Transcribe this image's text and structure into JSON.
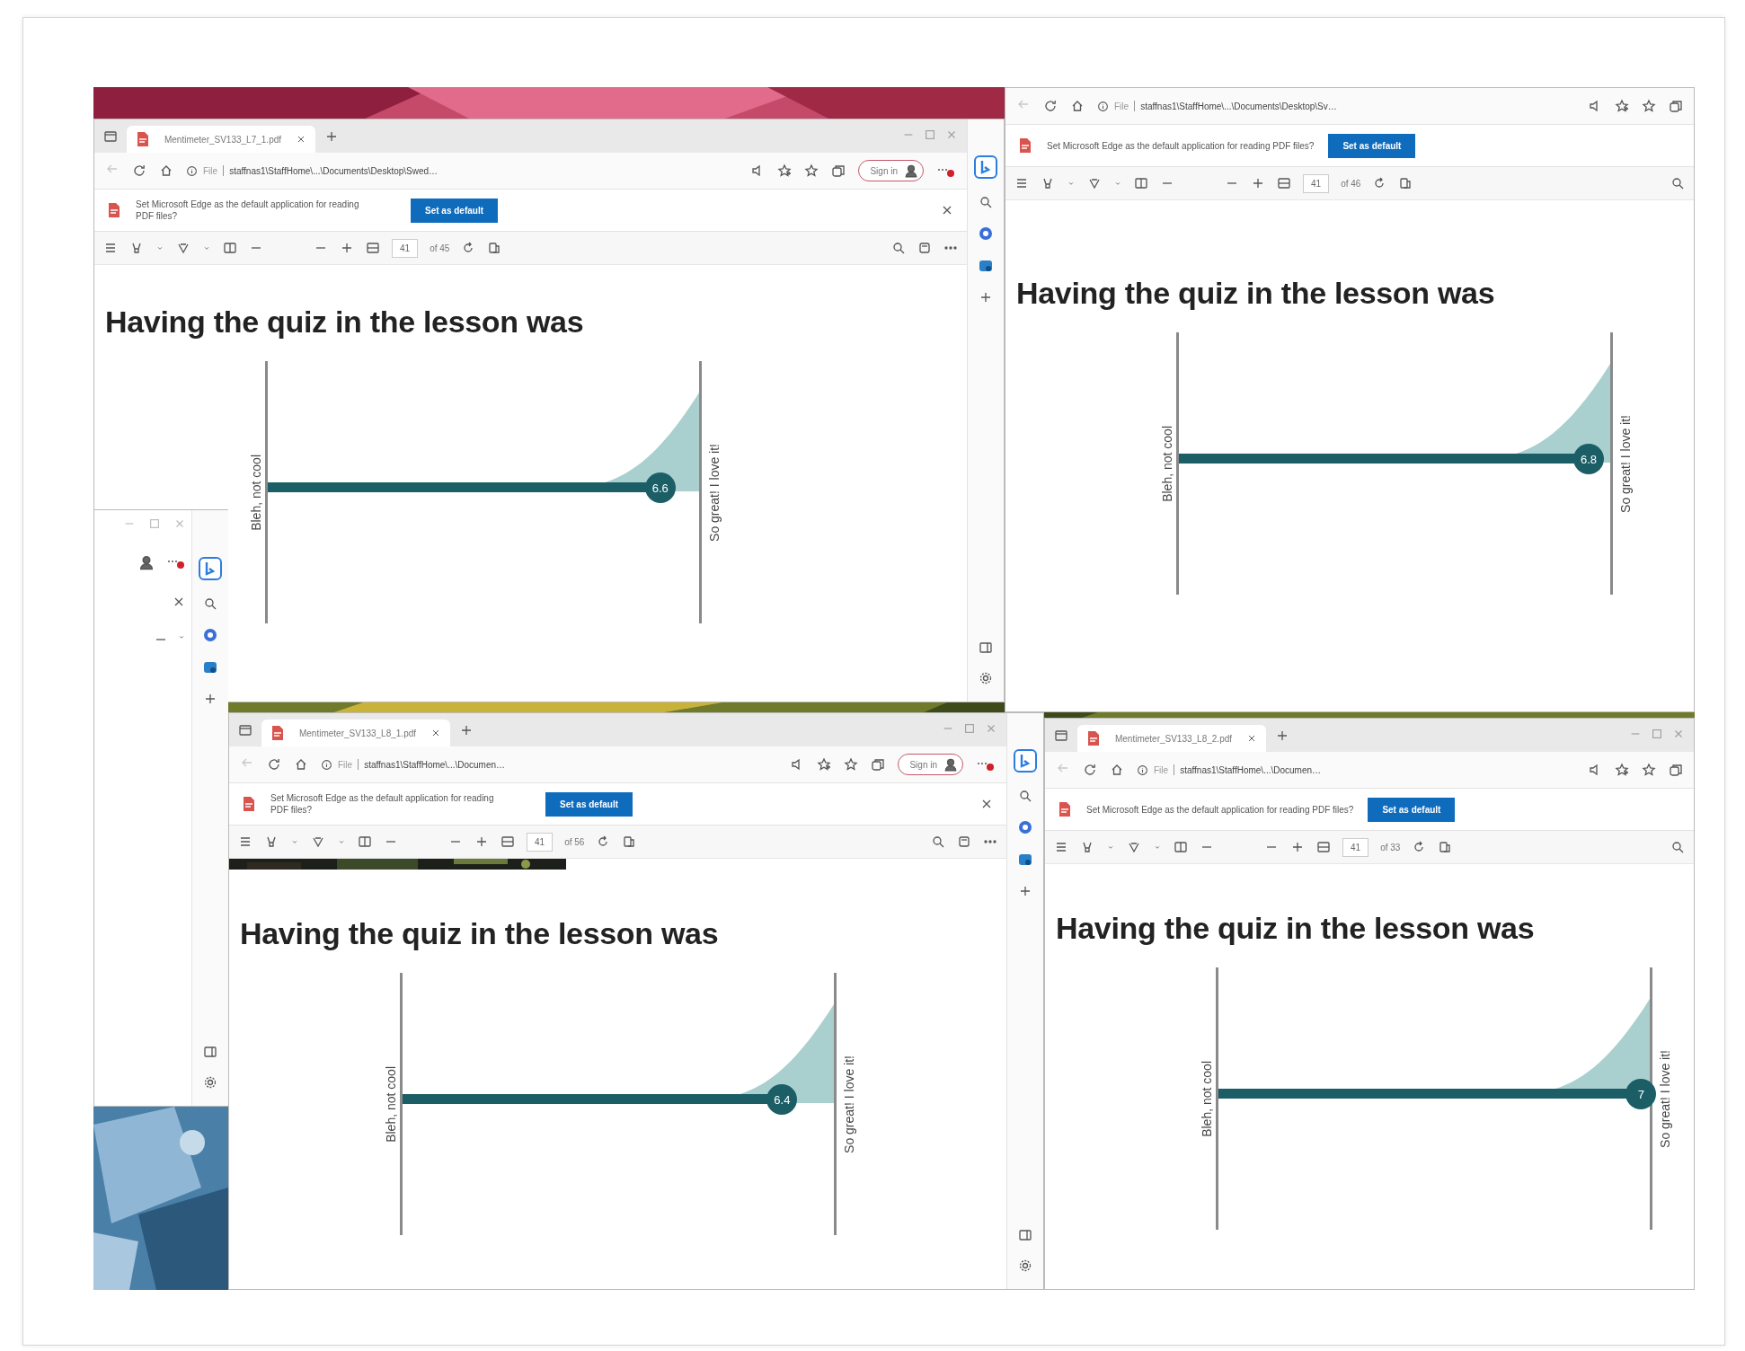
{
  "windows": [
    {
      "kind": "browser",
      "tab_title": "Mentimeter_SV133_L7_1.pdf",
      "address_scheme": "File",
      "address": "staffnas1\\StaffHome\\...\\Documents\\Desktop\\Swed…",
      "sign_in": "Sign in",
      "sidebar": true,
      "banner": {
        "text": "Set Microsoft Edge as the default application for reading PDF files?",
        "button": "Set as default"
      },
      "page": "41",
      "page_count": "of 45",
      "slide": {
        "title": "Having the quiz in the lesson was",
        "left_label": "Bleh, not cool",
        "right_label": "So great! I love it!",
        "value": "6.6",
        "level": 0.91
      }
    },
    {
      "kind": "browser",
      "address_scheme": "File",
      "address": "staffnas1\\StaffHome\\...\\Documents\\Desktop\\Sv…",
      "sidebar": false,
      "banner": {
        "text": "Set Microsoft Edge as the default application for reading PDF files?",
        "button": "Set as default"
      },
      "page": "41",
      "page_count": "of 46",
      "slide": {
        "title": "Having the quiz in the lesson was",
        "left_label": "Bleh, not cool",
        "right_label": "So great! I love it!",
        "value": "6.8",
        "level": 0.95
      }
    },
    {
      "kind": "edge"
    },
    {
      "kind": "browser",
      "tab_title": "Mentimeter_SV133_L8_1.pdf",
      "address_scheme": "File",
      "address": "staffnas1\\StaffHome\\...\\Documen…",
      "sign_in": "Sign in",
      "sidebar": true,
      "picture_strip": true,
      "banner": {
        "text": "Set Microsoft Edge as the default application for reading PDF files?",
        "button": "Set as default"
      },
      "page": "41",
      "page_count": "of 56",
      "slide": {
        "title": "Having the quiz in the lesson was",
        "left_label": "Bleh, not cool",
        "right_label": "So great! I love it!",
        "value": "6.4",
        "level": 0.88
      }
    },
    {
      "kind": "browser",
      "tab_title": "Mentimeter_SV133_L8_2.pdf",
      "address_scheme": "File",
      "address": "staffnas1\\StaffHome\\...\\Documen…",
      "sidebar": false,
      "banner": {
        "text": "Set Microsoft Edge as the default application for reading PDF files?",
        "button": "Set as default"
      },
      "page": "41",
      "page_count": "of 33",
      "slide": {
        "title": "Having the quiz in the lesson was",
        "left_label": "Bleh, not cool",
        "right_label": "So great! I love it!",
        "value": "7",
        "level": 0.98
      }
    }
  ]
}
